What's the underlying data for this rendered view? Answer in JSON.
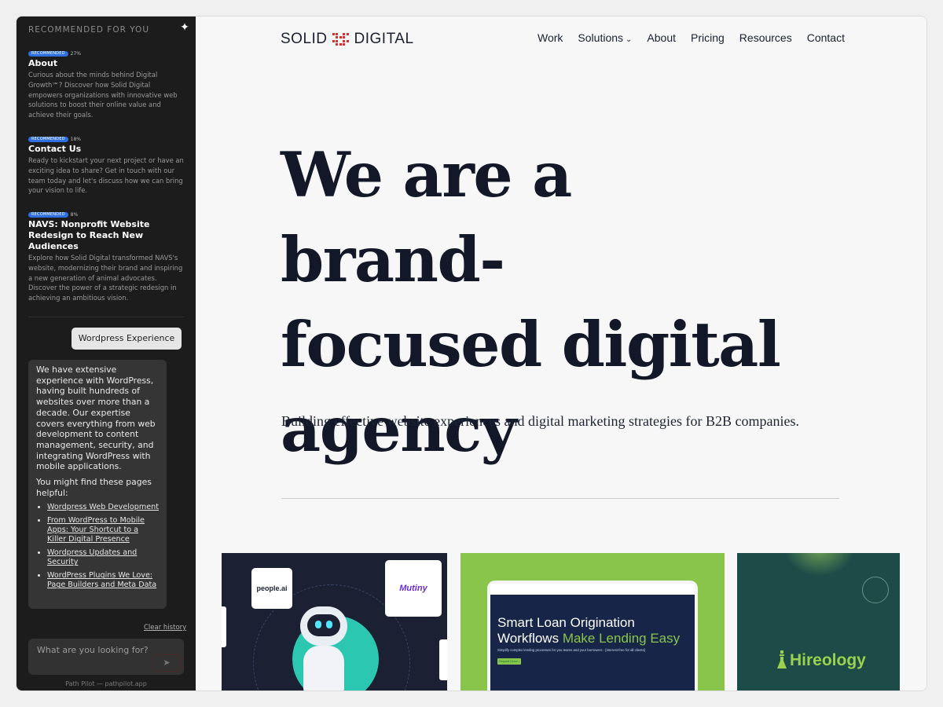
{
  "sidebar": {
    "header": "RECOMMENDED FOR YOU",
    "recommendations": [
      {
        "badge": "RECOMMENDED",
        "pct": "27%",
        "title": "About",
        "desc": "Curious about the minds behind Digital Growth℠? Discover how Solid Digital empowers organizations with innovative web solutions to boost their online value and achieve their goals."
      },
      {
        "badge": "RECOMMENDED",
        "pct": "18%",
        "title": "Contact Us",
        "desc": "Ready to kickstart your next project or have an exciting idea to share? Get in touch with our team today and let's discuss how we can bring your vision to life."
      },
      {
        "badge": "RECOMMENDED",
        "pct": "8%",
        "title": "NAVS: Nonprofit Website Redesign to Reach New Audiences",
        "desc": "Explore how Solid Digital transformed NAVS's website, modernizing their brand and inspiring a new generation of animal advocates. Discover the power of a strategic redesign in achieving an ambitious vision."
      }
    ],
    "user_message": "Wordpress Experience",
    "bot_message": {
      "paragraph": "We have extensive experience with WordPress, having built hundreds of websites over more than a decade. Our expertise covers everything from web development to content management, security, and integrating WordPress with mobile applications.",
      "helpful": "You might find these pages helpful:",
      "links": [
        "Wordpress Web Development",
        "From WordPress to Mobile Apps: Your Shortcut to a Killer Digital Presence",
        "Wordpress Updates and Security",
        "WordPress Plugins We Love: Page Builders and Meta Data"
      ]
    },
    "clear_history": "Clear history",
    "input_placeholder": "What are you looking for?",
    "footer": "Path Pilot — pathpilot.app"
  },
  "header": {
    "logo_left": "SOLID",
    "logo_right": "DIGITAL",
    "nav": [
      "Work",
      "Solutions",
      "About",
      "Pricing",
      "Resources",
      "Contact"
    ]
  },
  "hero": {
    "line1": "We are a brand-",
    "line2": "focused digital",
    "line3": "agency",
    "subhead": "Building effective website experiences and digital marketing strategies for B2B companies."
  },
  "cards": {
    "card1": {
      "tile1": "people.ai",
      "tile2": "Mutiny"
    },
    "card2": {
      "title_a": "Smart Loan Origination",
      "title_b": "Workflows ",
      "title_c": "Make Lending Easy",
      "sub": "Simplify complex lending processes for you teams and your borrowers · [Interest-free for all clients]",
      "btn": "Request Demo ›"
    },
    "card3": {
      "name": "Hireology"
    }
  }
}
